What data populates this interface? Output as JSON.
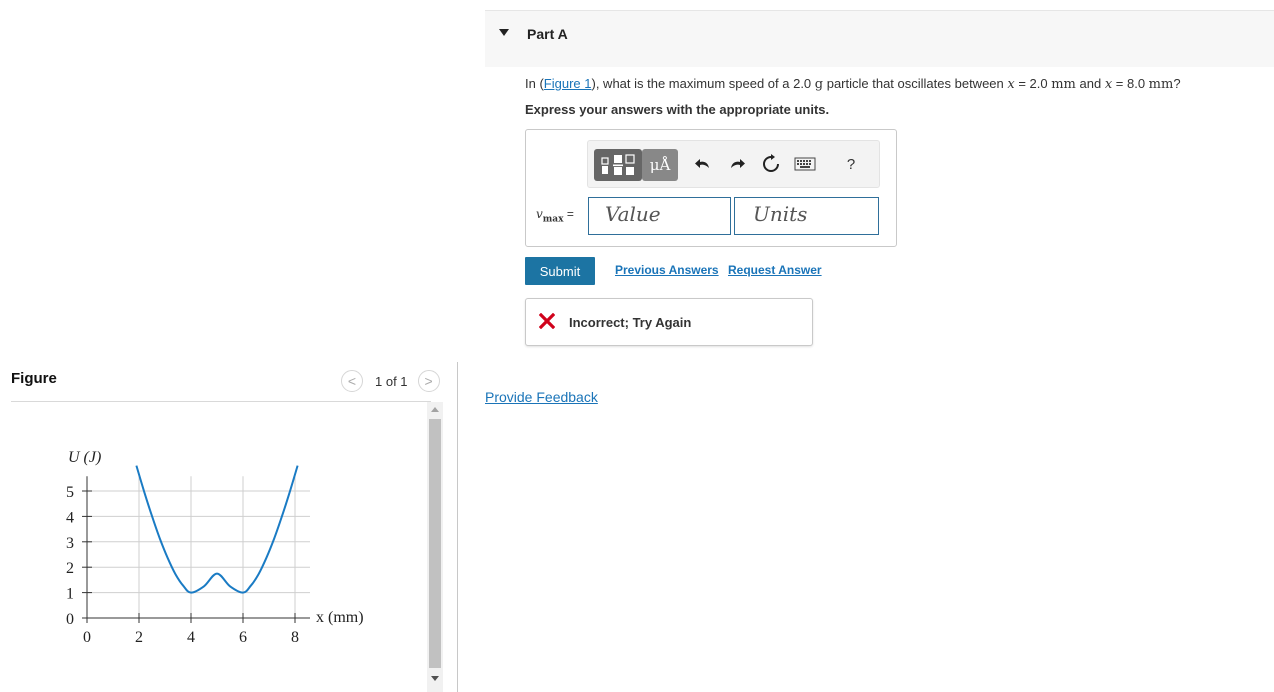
{
  "figure_panel": {
    "title": "Figure",
    "pager": {
      "prev": "<",
      "text": "1 of 1",
      "next": ">"
    }
  },
  "chart_data": {
    "type": "line",
    "ylabel": "U (J)",
    "xlabel": "x (mm)",
    "x_ticks": [
      0,
      2,
      4,
      6,
      8
    ],
    "y_ticks": [
      0,
      1,
      2,
      3,
      4,
      5
    ],
    "xlim": [
      0,
      8.5
    ],
    "ylim": [
      0,
      5.5
    ],
    "grid": true,
    "line_color": "#1a7bc4",
    "series": [
      {
        "points": [
          [
            1.9,
            6.0
          ],
          [
            2.2,
            4.97
          ],
          [
            2.5,
            4.01
          ],
          [
            2.8,
            3.13
          ],
          [
            3.1,
            2.37
          ],
          [
            3.4,
            1.73
          ],
          [
            3.7,
            1.27
          ],
          [
            4.0,
            1.0
          ],
          [
            4.5,
            1.25
          ],
          [
            5.0,
            1.75
          ],
          [
            5.5,
            1.25
          ],
          [
            6.0,
            1.0
          ],
          [
            6.3,
            1.27
          ],
          [
            6.6,
            1.73
          ],
          [
            6.9,
            2.37
          ],
          [
            7.2,
            3.13
          ],
          [
            7.5,
            4.01
          ],
          [
            7.8,
            4.97
          ],
          [
            8.1,
            6.0
          ]
        ]
      }
    ]
  },
  "part": {
    "title": "Part A",
    "question_prefix": "In (",
    "figure_link": "Figure 1",
    "question_mid": "), what is the maximum speed of a 2.0 ",
    "mass_unit": "g",
    "question_mid2": " particle that oscillates between ",
    "var1": "x",
    "eq1": " = 2.0 ",
    "len_unit1": "mm",
    "and_text": " and ",
    "var2": "x",
    "eq2": " = 8.0 ",
    "len_unit2": "mm",
    "question_end": "?",
    "instruction": "Express your answers with the appropriate units."
  },
  "answer": {
    "units_button": "μÅ",
    "help_button": "?",
    "var_label": "v",
    "var_sub": "max",
    "equals": "=",
    "value_placeholder": "Value",
    "units_placeholder": "Units"
  },
  "actions": {
    "submit": "Submit",
    "previous_answers": "Previous Answers",
    "request_answer": "Request Answer"
  },
  "feedback": {
    "text": "Incorrect; Try Again"
  },
  "provide_feedback": "Provide Feedback"
}
